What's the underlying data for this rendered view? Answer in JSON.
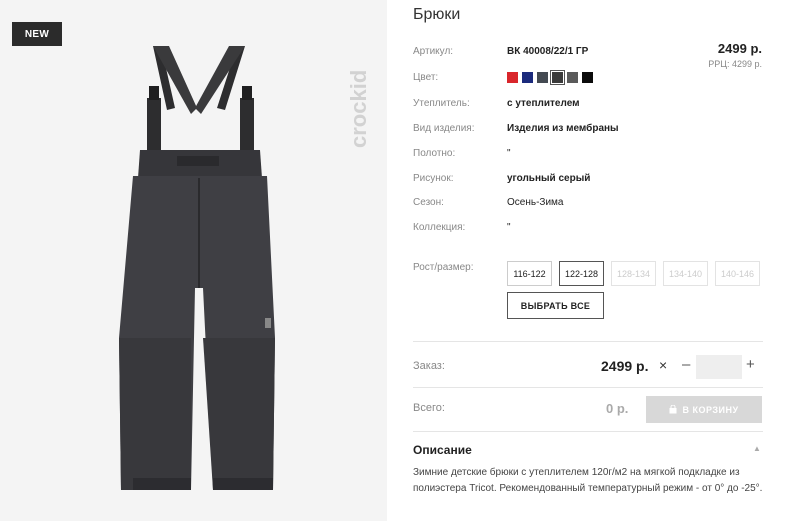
{
  "gallery": {
    "badge": "NEW",
    "brand": "crockid"
  },
  "product": {
    "title": "Брюки",
    "price": "2499 р.",
    "rrp": "РРЦ: 4299 р."
  },
  "specs": [
    {
      "label": "Артикул:",
      "value": "ВК 40008/22/1 ГР"
    },
    {
      "label": "Цвет:",
      "value": ""
    },
    {
      "label": "Утеплитель:",
      "value": "с утеплителем"
    },
    {
      "label": "Вид изделия:",
      "value": "Изделия из мембраны"
    },
    {
      "label": "Полотно:",
      "value": "\""
    },
    {
      "label": "Рисунок:",
      "value": "угольный серый"
    },
    {
      "label": "Сезон:",
      "value": "Осень-Зима"
    },
    {
      "label": "Коллекция:",
      "value": "\""
    },
    {
      "label": "Рост/размер:",
      "value": ""
    }
  ],
  "colors": [
    {
      "hex": "#d9262b",
      "selected": false
    },
    {
      "hex": "#1b2a7c",
      "selected": false
    },
    {
      "hex": "#444a52",
      "selected": false
    },
    {
      "hex": "#3a3a3a",
      "selected": true
    },
    {
      "hex": "#5a5a5a",
      "selected": false
    },
    {
      "hex": "#0b0b0b",
      "selected": false
    }
  ],
  "sizes": [
    {
      "label": "116-122",
      "state": "available"
    },
    {
      "label": "122-128",
      "state": "active"
    },
    {
      "label": "128-134",
      "state": "disabled"
    },
    {
      "label": "134-140",
      "state": "disabled"
    },
    {
      "label": "140-146",
      "state": "disabled"
    }
  ],
  "select_all_label": "ВЫБРАТЬ ВСЕ",
  "order": {
    "label": "Заказ:",
    "price": "2499 р.",
    "remove": "×",
    "minus": "–",
    "plus": "+",
    "quantity": ""
  },
  "total": {
    "label": "Всего:",
    "price": "0 р.",
    "cart_button": "В КОРЗИНУ"
  },
  "description": {
    "title": "Описание",
    "toggle": "▲",
    "text": "Зимние детские брюки с утеплителем 120г/м2 на мягкой подкладке из полиэстера Tricot. Рекомендованный температурный режим - от 0° до -25°."
  }
}
